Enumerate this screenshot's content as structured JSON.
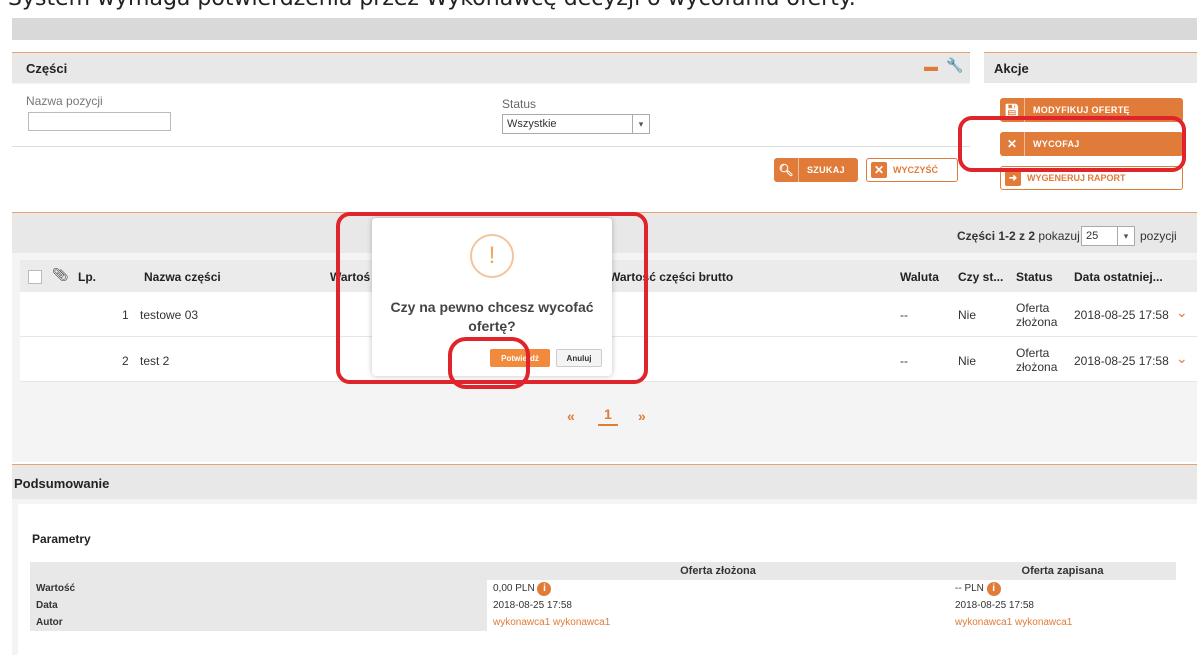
{
  "caption": "System wymaga potwierdzenia przez Wykonawcę decyzji o wycofaniu oferty.",
  "parts_panel": {
    "title": "Części",
    "name_label": "Nazwa pozycji",
    "name_value": "",
    "status_label": "Status",
    "status_value": "Wszystkie",
    "search_btn": "SZUKAJ",
    "clear_btn": "WYCZYŚĆ"
  },
  "actions_panel": {
    "title": "Akcje",
    "modify_btn": "MODYFIKUJ OFERTĘ",
    "withdraw_btn": "WYCOFAJ",
    "report_btn": "WYGENERUJ RAPORT"
  },
  "table": {
    "summary_prefix": "Części 1-2 z 2",
    "show_label": "pokazuj",
    "page_size": "25",
    "items_label": "pozycji",
    "headers": {
      "lp": "Lp.",
      "name": "Nazwa części",
      "value_net": "Wartoś",
      "value_gross": "Wartość części brutto",
      "currency": "Waluta",
      "czy": "Czy st...",
      "status": "Status",
      "date": "Data ostatniej..."
    },
    "rows": [
      {
        "lp": "1",
        "name": "testowe 03",
        "currency": "--",
        "czy": "Nie",
        "status_1": "Oferta",
        "status_2": "złożona",
        "date": "2018-08-25 17:58"
      },
      {
        "lp": "2",
        "name": "test 2",
        "currency": "--",
        "czy": "Nie",
        "status_1": "Oferta",
        "status_2": "złożona",
        "date": "2018-08-25 17:58"
      }
    ],
    "pager": {
      "prev": "«",
      "page": "1",
      "next": "»"
    }
  },
  "modal": {
    "icon": "!",
    "question_1": "Czy na pewno chcesz wycofać",
    "question_2": "ofertę?",
    "confirm": "Potwierdź",
    "cancel": "Anuluj"
  },
  "summary": {
    "title": "Podsumowanie",
    "params_title": "Parametry",
    "col_submitted": "Oferta złożona",
    "col_saved": "Oferta zapisana",
    "rows": [
      {
        "label": "Wartość",
        "submitted": "0,00 PLN",
        "saved": "-- PLN"
      },
      {
        "label": "Data",
        "submitted": "2018-08-25 17:58",
        "saved": "2018-08-25 17:58"
      },
      {
        "label": "Autor",
        "submitted": "wykonawca1 wykonawca1",
        "saved": "wykonawca1 wykonawca1"
      }
    ]
  },
  "colors": {
    "accent": "#e07b39",
    "highlight": "#e0242b"
  }
}
